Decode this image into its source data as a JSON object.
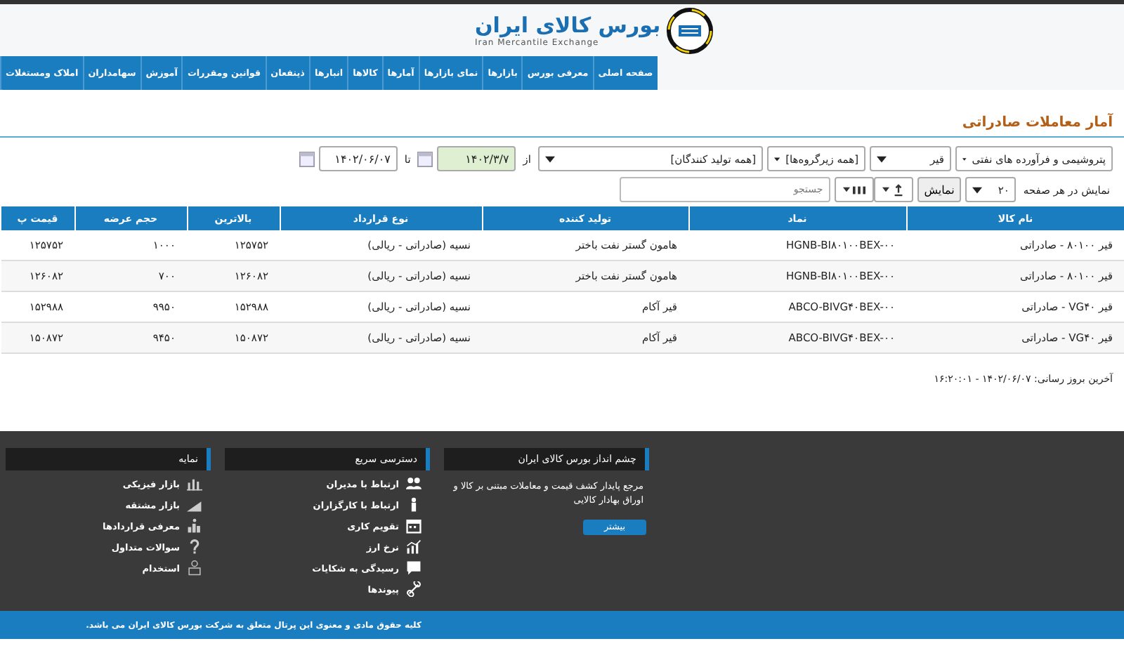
{
  "header": {
    "title": "بورس کالای ایران",
    "subtitle": "Iran Mercantile Exchange"
  },
  "nav": [
    "صفحه اصلی",
    "معرفی بورس",
    "بازارها",
    "نمای بازارها",
    "آمارها",
    "کالاها",
    "انبارها",
    "ذینفعان",
    "قوانین ومقررات",
    "آموزش",
    "سهامداران",
    "املاک ومستغلات"
  ],
  "page_title": "آمار معاملات صادراتی",
  "filters": {
    "group": "پتروشیمی و فرآورده های نفتی",
    "commodity": "قیر",
    "subgroup": "[همه زیرگروه‌ها]",
    "producer": "[همه تولید کنندگان]",
    "from_label": "از",
    "from_date": "۱۴۰۲/۳/۷",
    "to_label": "تا",
    "to_date": "۱۴۰۲/۰۶/۰۷"
  },
  "toolbar": {
    "page_size_label": "نمایش در هر صفحه",
    "page_size": "۲۰",
    "show_button": "نمایش",
    "search_placeholder": "جستجو"
  },
  "table": {
    "columns": [
      "نام کالا",
      "نماد",
      "تولید کننده",
      "نوع قرارداد",
      "بالاترین",
      "حجم عرضه",
      "قیمت پ"
    ],
    "rows": [
      [
        "قیر ۸۰۱۰۰ - صادراتی",
        "HGNB-BI۸۰۱۰۰BEX-۰۰",
        "هامون گستر نفت باختر",
        "نسیه (صادراتی - ریالی)",
        "۱۲۵۷۵۲",
        "۱۰۰۰",
        "۱۲۵۷۵۲"
      ],
      [
        "قیر ۸۰۱۰۰ - صادراتی",
        "HGNB-BI۸۰۱۰۰BEX-۰۰",
        "هامون گستر نفت باختر",
        "نسیه (صادراتی - ریالی)",
        "۱۲۶۰۸۲",
        "۷۰۰",
        "۱۲۶۰۸۲"
      ],
      [
        "قیر VG۴۰ - صادراتی",
        "ABCO-BIVG۴۰BEX-۰۰",
        "قیر آکام",
        "نسیه (صادراتی - ریالی)",
        "۱۵۲۹۸۸",
        "۹۹۵۰",
        "۱۵۲۹۸۸"
      ],
      [
        "قیر VG۴۰ - صادراتی",
        "ABCO-BIVG۴۰BEX-۰۰",
        "قیر آکام",
        "نسیه (صادراتی - ریالی)",
        "۱۵۰۸۷۲",
        "۹۴۵۰",
        "۱۵۰۸۷۲"
      ]
    ]
  },
  "last_update": "آخرین بروز رسانی: ۱۴۰۲/۰۶/۰۷ - ۱۶:۲۰:۰۱",
  "footer": {
    "vision": {
      "title": "چشم انداز بورس کالای ایران",
      "text": "مرجع پایدار کشف قیمت و معاملات مبتنی بر کالا و اوراق بهادار کالایی",
      "button": "بیشتر"
    },
    "quick_access": {
      "title": "دسترسی سریع",
      "links": [
        "ارتباط با مدیران",
        "ارتباط با کارگزاران",
        "تقویم کاری",
        "نرخ ارز",
        "رسیدگی به شکایات",
        "پیوندها"
      ]
    },
    "index": {
      "title": "نمایه",
      "links": [
        "بازار فیزیکی",
        "بازار مشتقه",
        "معرفی قراردادها",
        "سوالات متداول",
        "استخدام"
      ]
    },
    "copyright": "کلیه حقوق مادی و معنوی این پرتال متعلق به شرکت بورس کالای ایران می باشد."
  }
}
